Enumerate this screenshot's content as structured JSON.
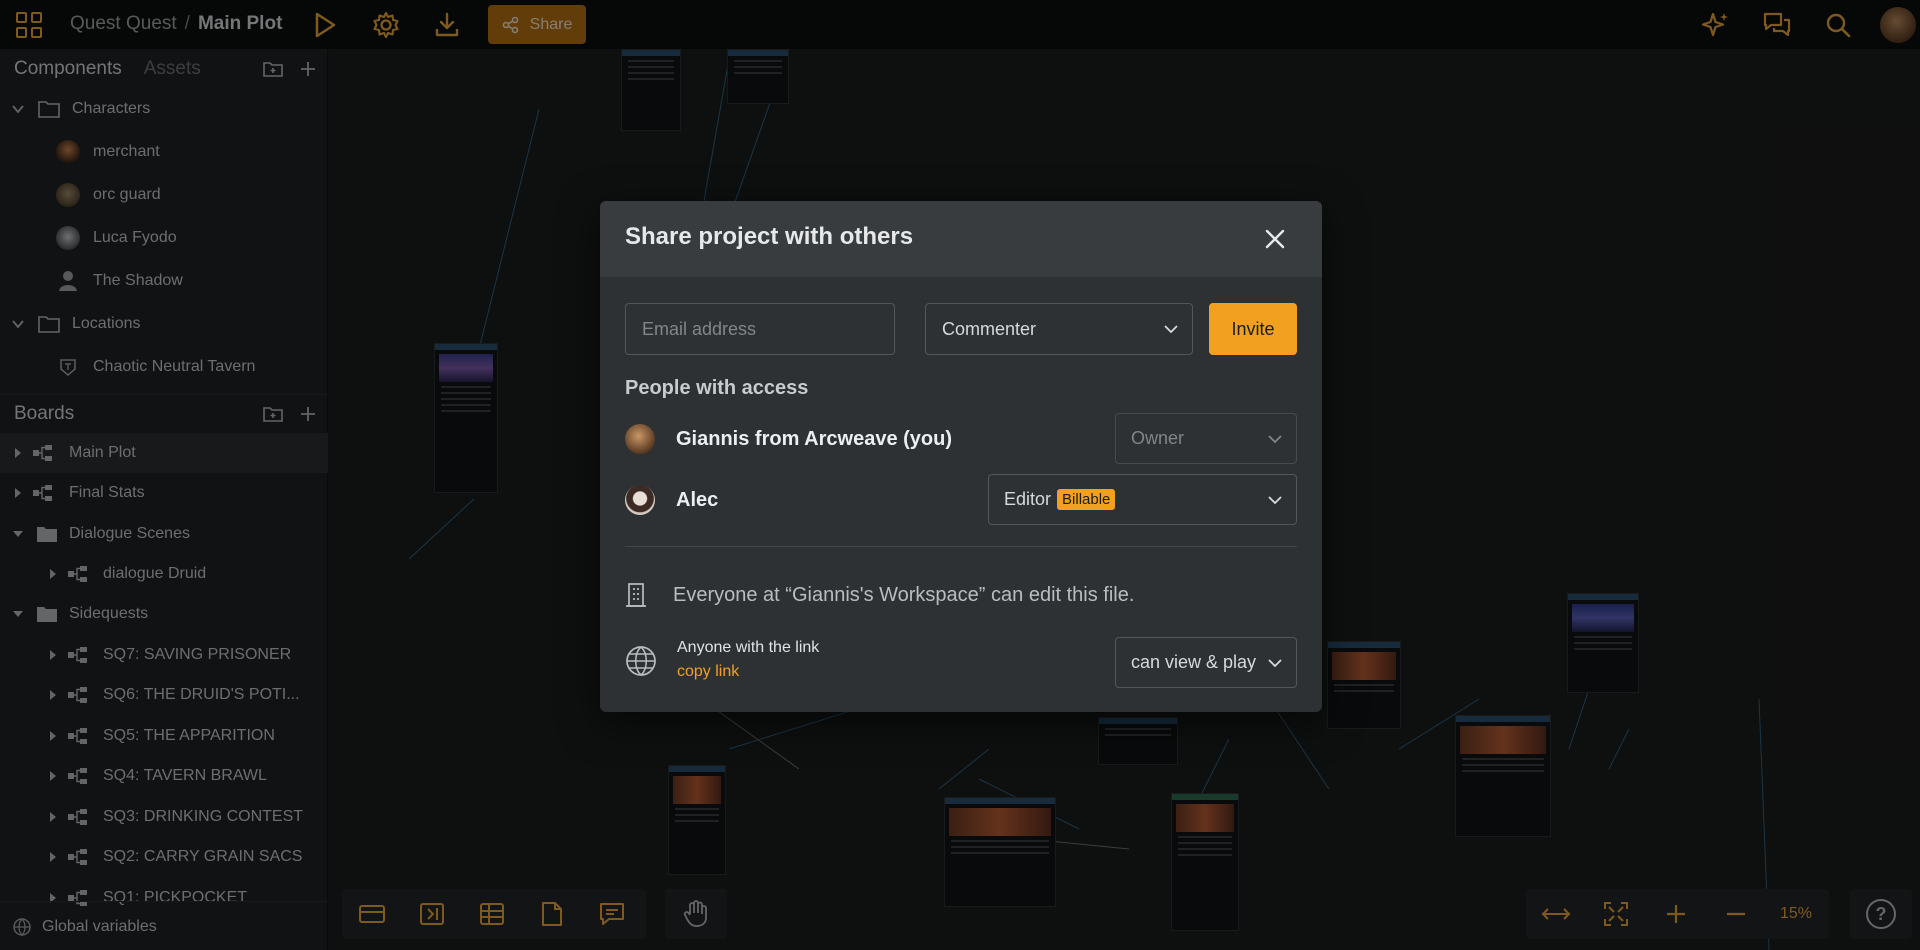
{
  "header": {
    "project": "Quest Quest",
    "separator": "/",
    "board": "Main Plot",
    "share_label": "Share",
    "accent": "#e8a43a"
  },
  "sidebar": {
    "components_tab": "Components",
    "assets_tab": "Assets",
    "characters_folder": "Characters",
    "characters": [
      "merchant",
      "orc guard",
      "Luca Fyodo",
      "The Shadow"
    ],
    "locations_folder": "Locations",
    "locations": [
      "Chaotic Neutral Tavern"
    ],
    "boards_title": "Boards",
    "boards": [
      "Main Plot",
      "Final Stats",
      "Dialogue Scenes",
      "dialogue Druid",
      "Sidequests",
      "SQ7: SAVING PRISONER",
      "SQ6: THE DRUID'S POTI...",
      "SQ5: THE APPARITION",
      "SQ4: TAVERN BRAWL",
      "SQ3: DRINKING CONTEST",
      "SQ2: CARRY GRAIN SACS",
      "SQ1: PICKPOCKET"
    ],
    "global_variables": "Global variables"
  },
  "toolbar": {
    "zoom": "15%",
    "help": "?"
  },
  "modal": {
    "title": "Share project with others",
    "email_placeholder": "Email address",
    "role_select": "Commenter",
    "invite_label": "Invite",
    "people_heading": "People with access",
    "people": [
      {
        "name": "Giannis from Arcweave (you)",
        "role": "Owner"
      },
      {
        "name": "Alec",
        "role": "Editor",
        "badge": "Billable"
      }
    ],
    "workspace_text": "Everyone at “Giannis's Workspace” can edit this file.",
    "link_title": "Anyone with the link",
    "copy_link": "copy link",
    "link_permission": "can view & play"
  }
}
